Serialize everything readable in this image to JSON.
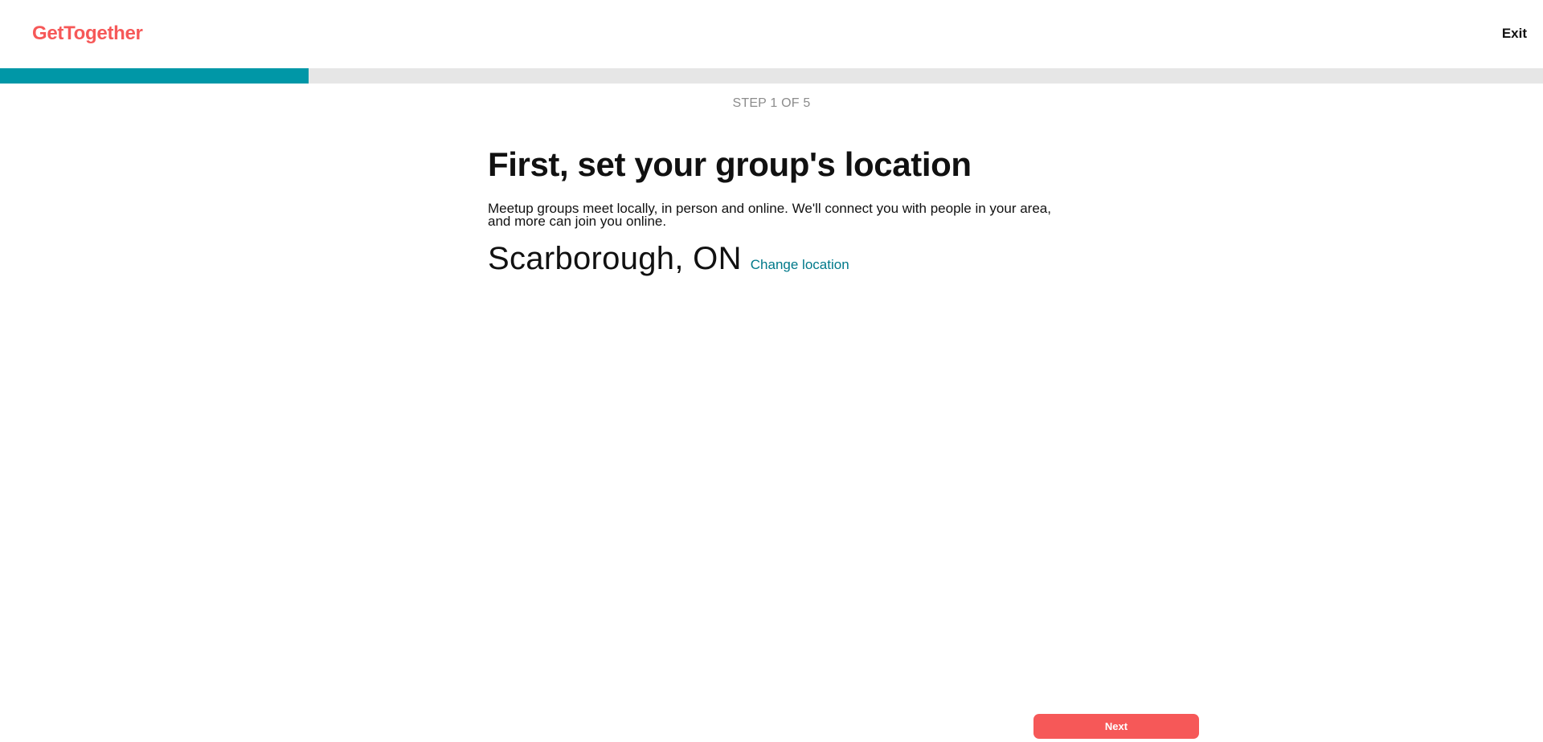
{
  "header": {
    "logo_text": "GetTogether",
    "exit_label": "Exit"
  },
  "progress": {
    "current_step": 1,
    "total_steps": 5,
    "fraction": 0.2,
    "step_label": "STEP 1 OF 5"
  },
  "main": {
    "title": "First, set your group's location",
    "description": "Meetup groups meet locally, in person and online. We'll connect you with people in your area, and more can join you online.",
    "location": "Scarborough, ON",
    "change_location_label": "Change location"
  },
  "footer": {
    "next_label": "Next"
  },
  "colors": {
    "brand": "#f65858",
    "accent": "#0097a7",
    "link": "#00798a",
    "track": "#e6e6e6",
    "muted_text": "#8c8c8c"
  }
}
